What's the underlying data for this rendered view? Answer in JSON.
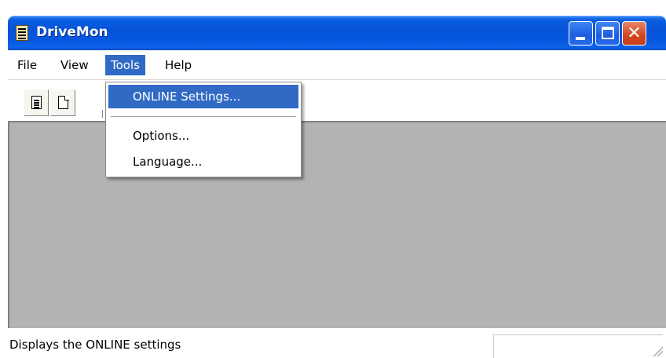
{
  "window": {
    "title": "DriveMon",
    "close_glyph": "✕"
  },
  "menubar": {
    "items": [
      {
        "label": "File"
      },
      {
        "label": "View"
      },
      {
        "label": "Tools"
      },
      {
        "label": "Help"
      }
    ],
    "open_menu": "Tools"
  },
  "toolbar": {
    "buttons": [
      {
        "icon": "document-lines-icon"
      },
      {
        "icon": "blank-document-icon"
      }
    ]
  },
  "tools_menu": {
    "items": [
      {
        "label": "ONLINE Settings...",
        "highlighted": true
      },
      {
        "label": "Options..."
      },
      {
        "label": "Language..."
      }
    ]
  },
  "statusbar": {
    "text": "Displays the ONLINE settings",
    "panel_text": ""
  },
  "colors": {
    "titlebar": "#0653d8",
    "menu_highlight": "#316ac5",
    "client_background": "#b3b3b3",
    "close_button": "#d2451c"
  }
}
